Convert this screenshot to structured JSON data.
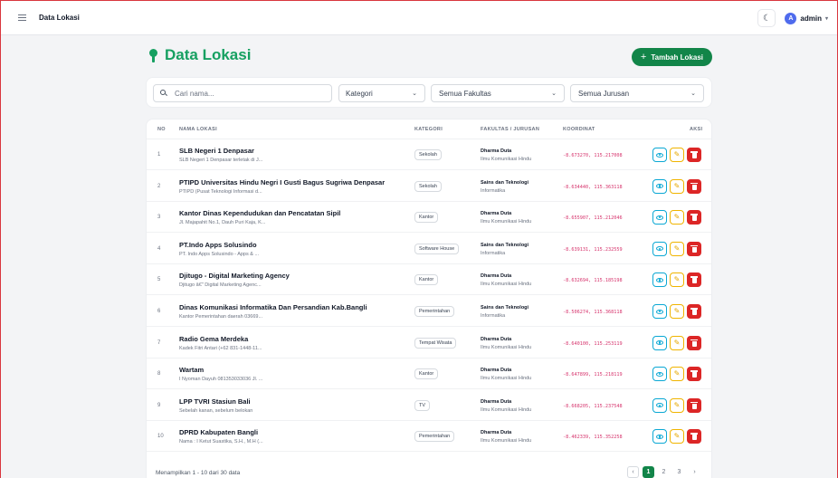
{
  "app": {
    "title": "Data Lokasi"
  },
  "topbar": {
    "theme_icon": "moon-icon",
    "user_name": "admin",
    "avatar_initial": "A"
  },
  "page": {
    "title": "Data Lokasi",
    "add_button": "Tambah Lokasi"
  },
  "filters": {
    "search_placeholder": "Cari nama...",
    "kategori": "Kategori",
    "fakultas": "Semua Fakultas",
    "jurusan": "Semua Jurusan"
  },
  "table": {
    "headers": {
      "no": "NO",
      "nama": "NAMA LOKASI",
      "kategori": "KATEGORI",
      "fakultas": "FAKULTAS / JURUSAN",
      "koordinat": "KOORDINAT",
      "aksi": "AKSI"
    },
    "rows": [
      {
        "no": "1",
        "name": "SLB Negeri 1 Denpasar",
        "desc": "SLB Negeri 1 Denpasar terletak di J...",
        "kategori": "Sekolah",
        "fakultas": "Dharma Duta",
        "jurusan": "Ilmu Komunikasi Hindu",
        "koordinat": "-8.673270, 115.217008"
      },
      {
        "no": "2",
        "name": "PTIPD Universitas Hindu Negri I Gusti Bagus Sugriwa Denpasar",
        "desc": "PTIPD (Pusat Teknologi Informasi d...",
        "kategori": "Sekolah",
        "fakultas": "Sains dan Teknologi",
        "jurusan": "Informatika",
        "koordinat": "-8.634440, 115.363118"
      },
      {
        "no": "3",
        "name": "Kantor Dinas Kependudukan dan Pencatatan Sipil",
        "desc": "Jl. Majapahit No.1, Dauh Puri Kaja, K...",
        "kategori": "Kantor",
        "fakultas": "Dharma Duta",
        "jurusan": "Ilmu Komunikasi Hindu",
        "koordinat": "-8.655907, 115.212046"
      },
      {
        "no": "4",
        "name": "PT.Indo Apps Solusindo",
        "desc": "PT. Indo Apps Solusindo - Apps & ...",
        "kategori": "Software House",
        "fakultas": "Sains dan Teknologi",
        "jurusan": "Informatika",
        "koordinat": "-8.639131, 115.232559"
      },
      {
        "no": "5",
        "name": "Djitugo - Digital Marketing Agency",
        "desc": "Djitugo â€\" Digital Marketing Agenc...",
        "kategori": "Kantor",
        "fakultas": "Dharma Duta",
        "jurusan": "Ilmu Komunikasi Hindu",
        "koordinat": "-8.632694, 115.185198"
      },
      {
        "no": "6",
        "name": "Dinas Komunikasi Informatika Dan Persandian Kab.Bangli",
        "desc": "Kantor Pemerintahan daerah 03669...",
        "kategori": "Pemerintahan",
        "fakultas": "Sains dan Teknologi",
        "jurusan": "Informatika",
        "koordinat": "-8.506274, 115.368118"
      },
      {
        "no": "7",
        "name": "Radio Gema Merdeka",
        "desc": "Kadek Fitri Antari (+62 831-1448-11...",
        "kategori": "Tempat Wisata",
        "fakultas": "Dharma Duta",
        "jurusan": "Ilmu Komunikasi Hindu",
        "koordinat": "-8.640100, 115.253119"
      },
      {
        "no": "8",
        "name": "Wartam",
        "desc": "I Nyoman Dayuh 081353033036 Jl. ...",
        "kategori": "Kantor",
        "fakultas": "Dharma Duta",
        "jurusan": "Ilmu Komunikasi Hindu",
        "koordinat": "-8.647899, 115.218119"
      },
      {
        "no": "9",
        "name": "LPP TVRI Stasiun Bali",
        "desc": "Sebelah kanan, sebelum belokan",
        "kategori": "TV",
        "fakultas": "Dharma Duta",
        "jurusan": "Ilmu Komunikasi Hindu",
        "koordinat": "-8.668205, 115.237548"
      },
      {
        "no": "10",
        "name": "DPRD Kabupaten Bangli",
        "desc": "Nama : I Ketut Suastika, S.H., M.H (...",
        "kategori": "Pemerintahan",
        "fakultas": "Dharma Duta",
        "jurusan": "Ilmu Komunikasi Hindu",
        "koordinat": "-8.462339, 115.352258"
      }
    ]
  },
  "footer": {
    "summary": "Menampilkan 1 - 10 dari 30 data",
    "pages": [
      "1",
      "2",
      "3"
    ],
    "active_page": "1"
  },
  "colors": {
    "primary": "#128549",
    "title": "#16a061",
    "coord": "#d6336c",
    "view": "#0ba8d4",
    "edit": "#f0b400",
    "delete": "#dc2626"
  }
}
